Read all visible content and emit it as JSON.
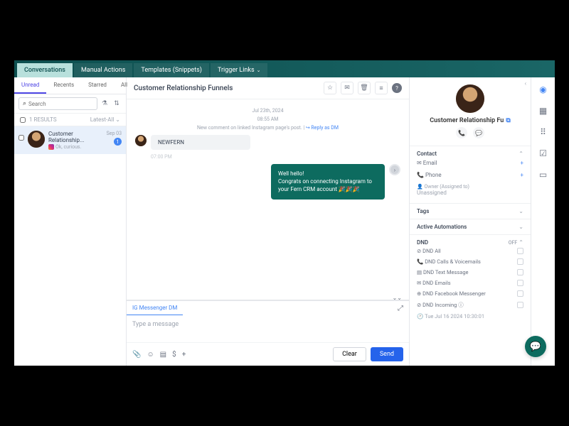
{
  "nav": {
    "tabs": [
      "Conversations",
      "Manual Actions",
      "Templates (Snippets)",
      "Trigger Links"
    ],
    "activeIndex": 0
  },
  "filters": {
    "tabs": [
      "Unread",
      "Recents",
      "Starred",
      "All"
    ],
    "activeIndex": 0
  },
  "search": {
    "placeholder": "Search"
  },
  "results": {
    "label": "1 RESULTS",
    "sort": "Latest-All"
  },
  "convItem": {
    "title": "Customer Relationship...",
    "preview": "Ok, curious.",
    "date": "Sep 03",
    "unread": "1"
  },
  "chat": {
    "title": "Customer Relationship Funnels",
    "date": "Jul 23th, 2024",
    "time1": "08:55 AM",
    "sysMsg": "New comment on linked Instagram page's post.",
    "sysReply": "↪ Reply as DM",
    "inbound": "NEWFERN",
    "time2": "07:00 PM",
    "outbound": "Well hello!\nCongrats on connecting Instagram to your Fern CRM account 🎉🎉🎉"
  },
  "composer": {
    "tab": "IG Messenger DM",
    "placeholder": "Type a message",
    "clear": "Clear",
    "send": "Send"
  },
  "contact": {
    "name": "Customer Relationship Fu",
    "sections": {
      "contact": "Contact",
      "email": "Email",
      "phone": "Phone",
      "owner": "Owner (Assigned to)",
      "ownerVal": "Unassigned",
      "tags": "Tags",
      "auto": "Active Automations",
      "dnd": "DND",
      "dndStatus": "OFF"
    },
    "dndItems": [
      "DND All",
      "DND Calls & Voicemails",
      "DND Text Message",
      "DND Emails",
      "DND Facebook Messenger",
      "DND Incoming ⓘ"
    ],
    "timestamp": "Tue Jul 16 2024 10:30:01"
  }
}
